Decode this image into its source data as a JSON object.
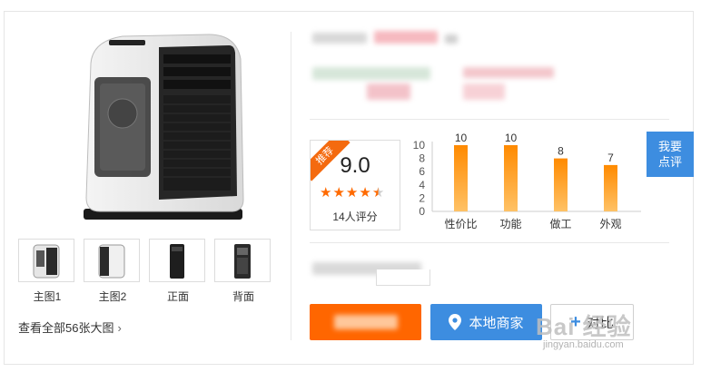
{
  "gallery": {
    "thumbnails": [
      {
        "label": "主图1"
      },
      {
        "label": "主图2"
      },
      {
        "label": "正面"
      },
      {
        "label": "背面"
      }
    ],
    "view_all_label": "查看全部56张大图",
    "view_all_icon": "chevron-right-icon"
  },
  "rating": {
    "badge": "推荐",
    "score": "9.0",
    "stars_value": 4.5,
    "stars_max": 5,
    "votes": "14人评分"
  },
  "chart_data": {
    "type": "bar",
    "categories": [
      "性价比",
      "功能",
      "做工",
      "外观"
    ],
    "values": [
      10,
      10,
      8,
      7
    ],
    "ylim": [
      0,
      10
    ],
    "yticks": [
      0,
      2,
      4,
      6,
      8,
      10
    ],
    "data_labels": [
      "10",
      "10",
      "8",
      "7"
    ],
    "bar_color": "#ff9a1a",
    "grid": false
  },
  "actions": {
    "local_dealer_label": "本地商家",
    "local_dealer_icon": "location-pin-icon",
    "compare_label": "对比",
    "compare_icon": "plus-icon"
  },
  "review_tab": {
    "line1": "我要",
    "line2": "点评"
  },
  "watermark": {
    "main": "Bai 经验",
    "sub": "jingyan.baidu.com"
  },
  "colors": {
    "accent_orange": "#ff6600",
    "accent_blue": "#3d8de0",
    "star": "#ff6a00",
    "ribbon": "#f46a0f"
  }
}
